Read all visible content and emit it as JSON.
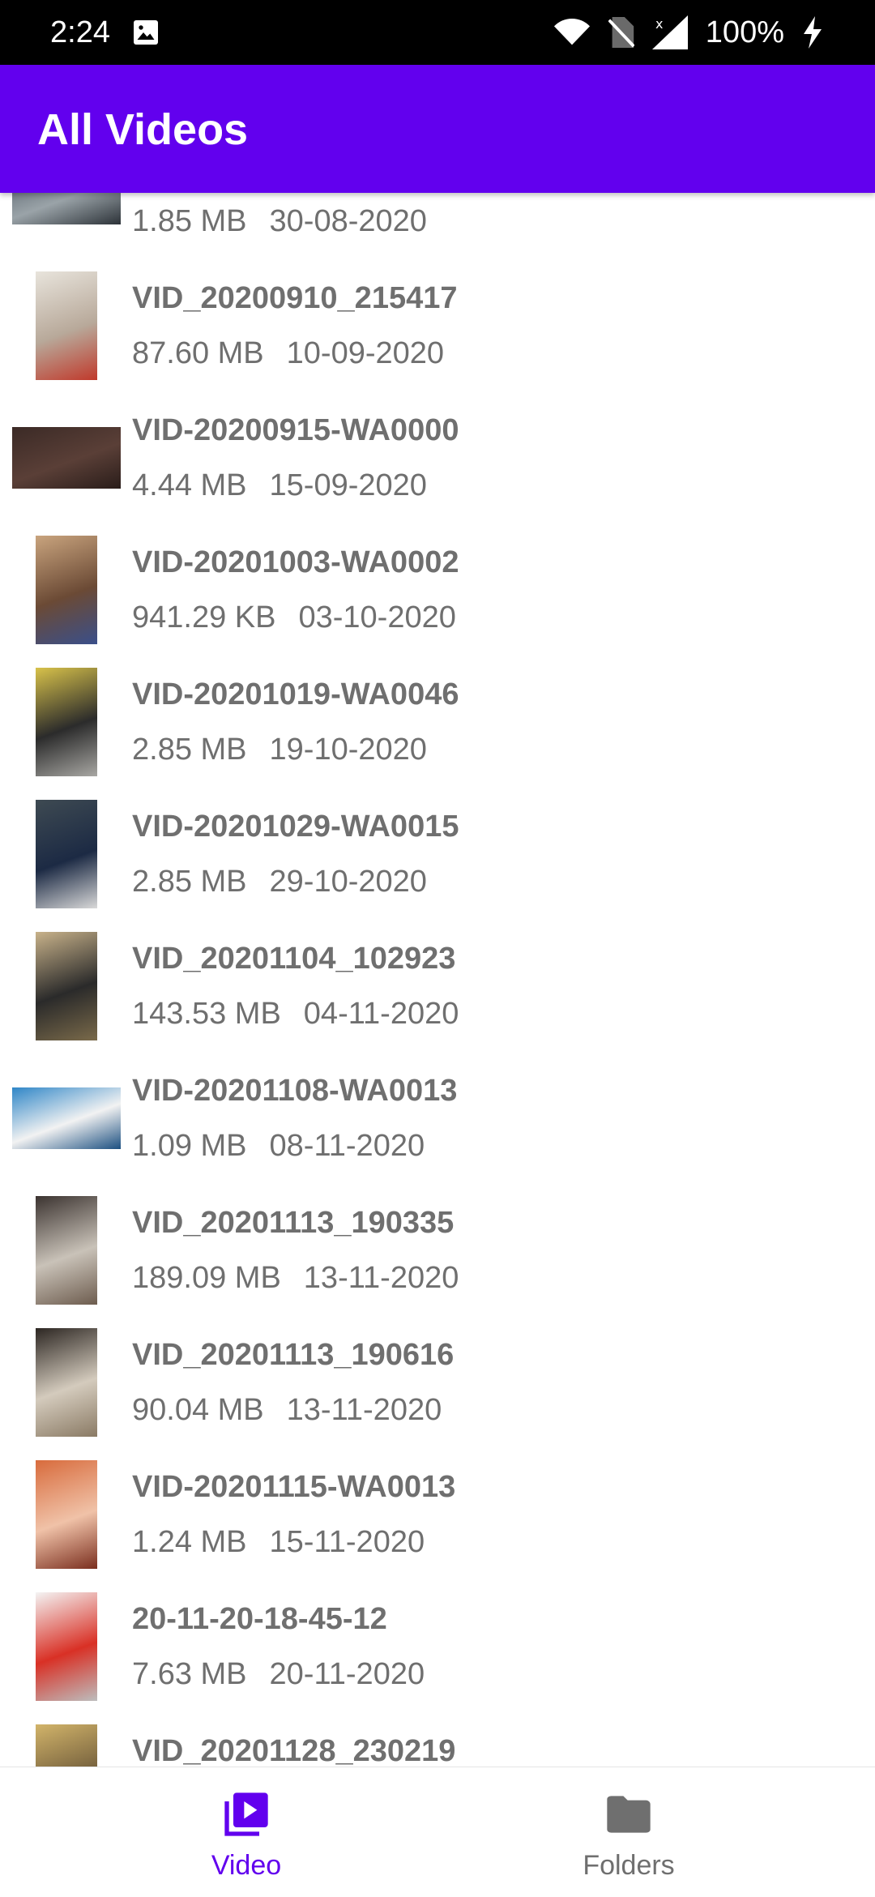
{
  "status_bar": {
    "time": "2:24",
    "battery": "100%",
    "icons": [
      "image-icon",
      "wifi-icon",
      "no-sim-icon",
      "signal-icon",
      "charging-icon"
    ]
  },
  "app_bar": {
    "title": "All Videos",
    "color": "#6200ee"
  },
  "videos": [
    {
      "name": "",
      "size": "1.85 MB",
      "date": "30-08-2020",
      "thumb": "landscape",
      "colors": [
        "#4a5560",
        "#9aa3a8",
        "#2c3238"
      ]
    },
    {
      "name": "VID_20200910_215417",
      "size": "87.60 MB",
      "date": "10-09-2020",
      "thumb": "portrait",
      "colors": [
        "#e8e4dc",
        "#b8a99a",
        "#c0392b"
      ]
    },
    {
      "name": "VID-20200915-WA0000",
      "size": "4.44 MB",
      "date": "15-09-2020",
      "thumb": "landscape",
      "colors": [
        "#3b2a26",
        "#5a3f37",
        "#2a1d1a"
      ]
    },
    {
      "name": "VID-20201003-WA0002",
      "size": "941.29 KB",
      "date": "03-10-2020",
      "thumb": "portrait",
      "colors": [
        "#c9a47e",
        "#6b4a35",
        "#3a4f8a"
      ]
    },
    {
      "name": "VID-20201019-WA0046",
      "size": "2.85 MB",
      "date": "19-10-2020",
      "thumb": "portrait",
      "colors": [
        "#d8c24a",
        "#2b2b2b",
        "#a8a7a3"
      ]
    },
    {
      "name": "VID-20201029-WA0015",
      "size": "2.85 MB",
      "date": "29-10-2020",
      "thumb": "portrait",
      "colors": [
        "#3e4a52",
        "#1c2a44",
        "#d9d9d9"
      ]
    },
    {
      "name": "VID_20201104_102923",
      "size": "143.53 MB",
      "date": "04-11-2020",
      "thumb": "portrait",
      "colors": [
        "#c8b28a",
        "#2a2a2a",
        "#7a6a4a"
      ]
    },
    {
      "name": "VID-20201108-WA0013",
      "size": "1.09 MB",
      "date": "08-11-2020",
      "thumb": "landscape",
      "colors": [
        "#2f86c7",
        "#f2f2f2",
        "#1b4f80"
      ]
    },
    {
      "name": "VID_20201113_190335",
      "size": "189.09 MB",
      "date": "13-11-2020",
      "thumb": "portrait",
      "colors": [
        "#3b3330",
        "#c9c2b8",
        "#6d5c4e"
      ]
    },
    {
      "name": "VID_20201113_190616",
      "size": "90.04 MB",
      "date": "13-11-2020",
      "thumb": "portrait",
      "colors": [
        "#2c2622",
        "#d4cbbd",
        "#8a7a64"
      ]
    },
    {
      "name": "VID-20201115-WA0013",
      "size": "1.24 MB",
      "date": "15-11-2020",
      "thumb": "portrait",
      "colors": [
        "#d86b3c",
        "#f0c2a8",
        "#7a2e1e"
      ]
    },
    {
      "name": "20-11-20-18-45-12",
      "size": "7.63 MB",
      "date": "20-11-2020",
      "thumb": "portrait",
      "colors": [
        "#f4f4f4",
        "#d93025",
        "#bdbdbd"
      ]
    },
    {
      "name": "VID_20201128_230219",
      "size": "",
      "date": "",
      "thumb": "portrait",
      "colors": [
        "#d2b46a",
        "#6e5a3a",
        "#f0e6c8"
      ]
    }
  ],
  "bottom_nav": {
    "items": [
      {
        "label": "Video",
        "icon": "video-library-icon",
        "active": true,
        "color": "#6200ee"
      },
      {
        "label": "Folders",
        "icon": "folder-icon",
        "active": false,
        "color": "#6f6f6f"
      }
    ]
  }
}
